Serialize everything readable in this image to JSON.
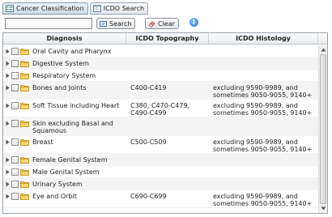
{
  "tabs": [
    {
      "label": "Cancer Classification",
      "icon": "tree-list-icon",
      "active": true
    },
    {
      "label": "ICDO Search",
      "icon": "table-icon",
      "active": false
    }
  ],
  "toolbar": {
    "search_value": "",
    "search_label": "Search",
    "clear_label": "Clear",
    "info_symbol": "i"
  },
  "grid": {
    "columns": [
      "Diagnosis",
      "ICDO Topography",
      "ICDO Histology"
    ],
    "rows": [
      {
        "diagnosis": "Oral Cavity and Pharynx",
        "topography": "",
        "histology": ""
      },
      {
        "diagnosis": "Digestive System",
        "topography": "",
        "histology": ""
      },
      {
        "diagnosis": "Respiratory System",
        "topography": "",
        "histology": ""
      },
      {
        "diagnosis": "Bones and Joints",
        "topography": "C400-C419",
        "histology": "excluding 9590-9989, and sometimes 9050-9055, 9140+"
      },
      {
        "diagnosis": "Soft Tissue including Heart",
        "topography": "C380, C470-C479, C490-C499",
        "histology": "excluding 9590-9989, and sometimes 9050-9055, 9140+"
      },
      {
        "diagnosis": "Skin excluding Basal and Squamous",
        "topography": "",
        "histology": ""
      },
      {
        "diagnosis": "Breast",
        "topography": "C500-C509",
        "histology": "excluding 9590-9989, and sometimes 9050-9055, 9140+"
      },
      {
        "diagnosis": "Female Genital System",
        "topography": "",
        "histology": ""
      },
      {
        "diagnosis": "Male Genital System",
        "topography": "",
        "histology": ""
      },
      {
        "diagnosis": "Urinary System",
        "topography": "",
        "histology": ""
      },
      {
        "diagnosis": "Eye and Orbit",
        "topography": "C690-C699",
        "histology": "excluding 9590-9989, and sometimes 9050-9055, 9140+"
      }
    ]
  },
  "colors": {
    "folder": "#f3c64b",
    "row_alt": "#f4f4f4",
    "info": "#1e6fd6"
  }
}
